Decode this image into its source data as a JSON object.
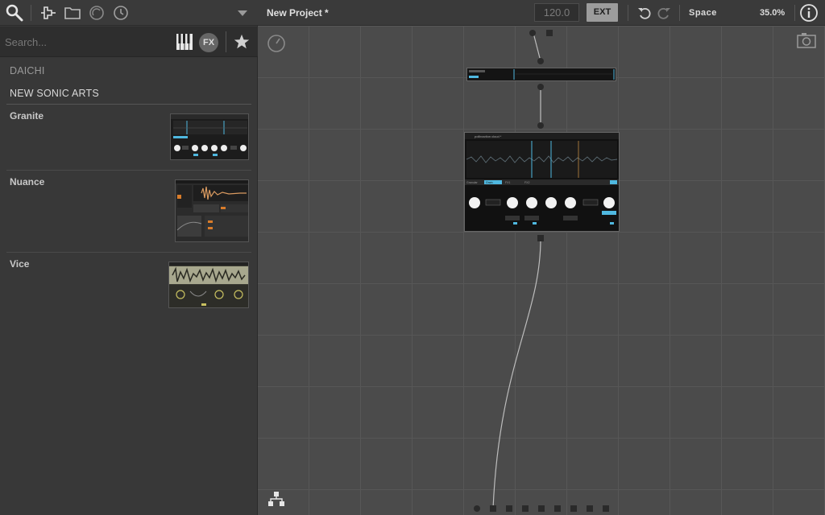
{
  "sidebar": {
    "search_placeholder": "Search...",
    "fx_label": "FX",
    "vendors": [
      "DAICHI",
      "NEW SONIC ARTS"
    ],
    "items": [
      {
        "name": "Granite"
      },
      {
        "name": "Nuance"
      },
      {
        "name": "Vice"
      }
    ]
  },
  "header": {
    "project_title": "New Project *",
    "tempo": "120.0",
    "ext_label": "EXT",
    "space_label": "Space",
    "zoom": "35.0%"
  },
  "canvas": {
    "effect_node_title": "pollinaction cloud *",
    "effect_tabs": [
      "Granular",
      "Grain",
      "FX1",
      "FX2"
    ]
  },
  "colors": {
    "accent": "#4fb8e0",
    "orange": "#d97c2a",
    "yellow": "#c8c060"
  }
}
